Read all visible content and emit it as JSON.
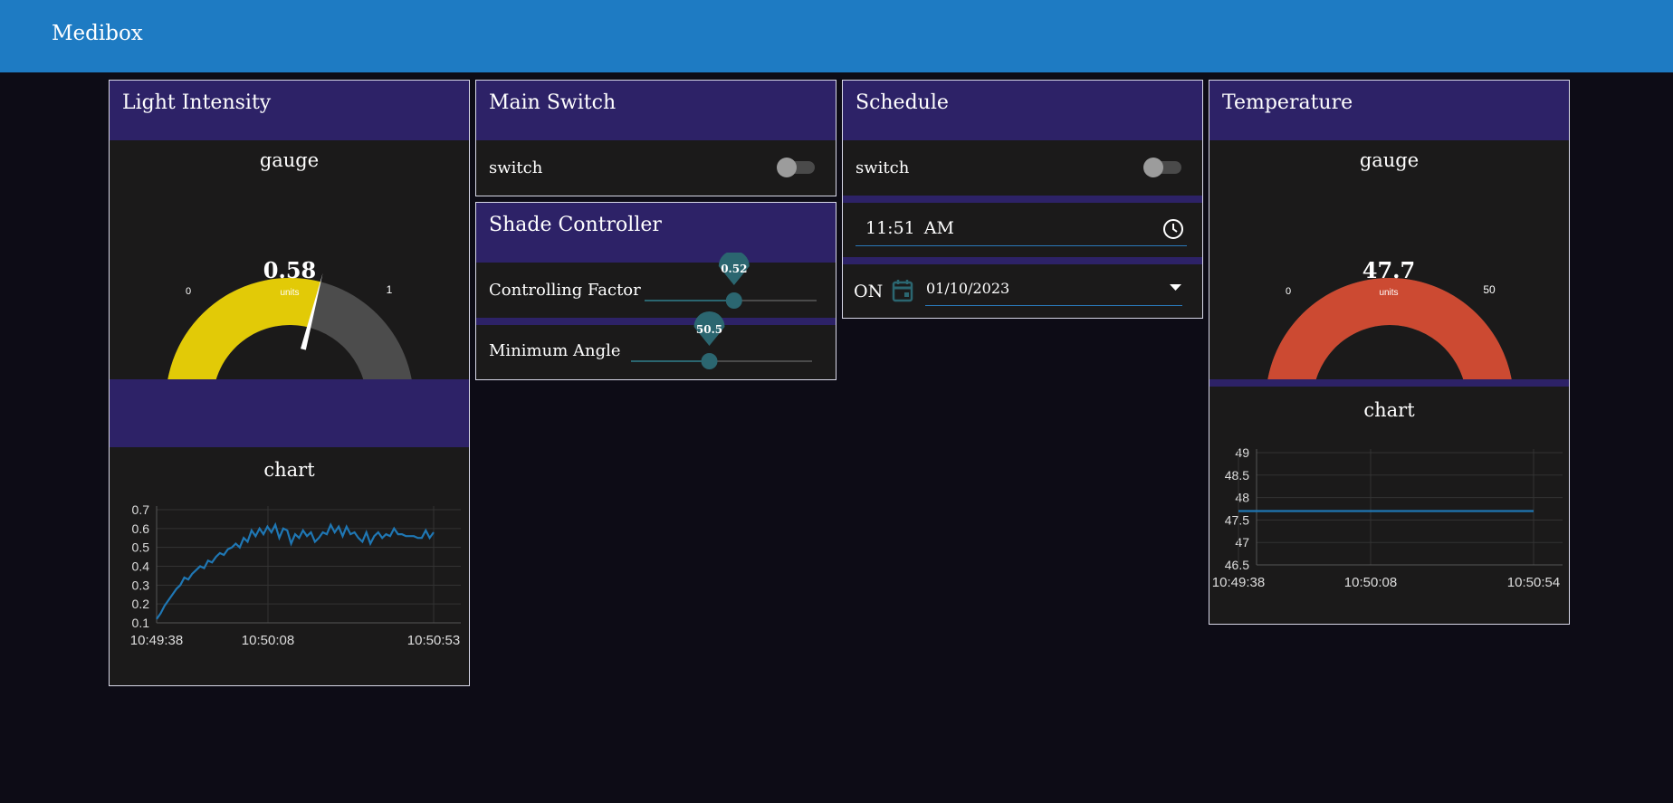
{
  "app": {
    "title": "Medibox"
  },
  "light_intensity": {
    "title": "Light Intensity",
    "gauge": {
      "label": "gauge",
      "value": "0.58",
      "value_num": 0.58,
      "min": "0",
      "max": "1",
      "min_num": 0,
      "max_num": 1,
      "units": "units",
      "color": "#e2ca07"
    },
    "chart_title": "chart"
  },
  "main_switch": {
    "title": "Main Switch",
    "switch_label": "switch",
    "on": false
  },
  "shade_controller": {
    "title": "Shade Controller",
    "controlling_factor": {
      "label": "Controlling Factor",
      "value": "0.52",
      "fraction": 0.52
    },
    "minimum_angle": {
      "label": "Minimum Angle",
      "value": "50.5",
      "fraction": 0.42
    }
  },
  "schedule": {
    "title": "Schedule",
    "switch_label": "switch",
    "on": false,
    "time": "11:51 AM",
    "on_label": "ON",
    "date": "01/10/2023"
  },
  "temperature": {
    "title": "Temperature",
    "gauge": {
      "label": "gauge",
      "value": "47.7",
      "value_num": 47.7,
      "min": "0",
      "max": "50",
      "min_num": 0,
      "max_num": 50,
      "units": "units",
      "color": "#cc4a32"
    },
    "chart_title": "chart"
  },
  "chart_data": [
    {
      "type": "line",
      "title": "chart",
      "x_ticks": [
        "10:49:38",
        "10:50:08",
        "10:50:53"
      ],
      "y_ticks": [
        "0.1",
        "0.2",
        "0.3",
        "0.4",
        "0.5",
        "0.6",
        "0.7"
      ],
      "ylim": [
        0.1,
        0.7
      ],
      "x_seconds_range": [
        0,
        75
      ],
      "color": "#1f77b4",
      "grid": true,
      "series": [
        {
          "values": [
            0.12,
            0.15,
            0.19,
            0.22,
            0.25,
            0.28,
            0.3,
            0.34,
            0.33,
            0.36,
            0.38,
            0.4,
            0.39,
            0.43,
            0.42,
            0.45,
            0.47,
            0.46,
            0.49,
            0.5,
            0.52,
            0.5,
            0.55,
            0.53,
            0.59,
            0.56,
            0.6,
            0.57,
            0.61,
            0.58,
            0.62,
            0.55,
            0.6,
            0.59,
            0.52,
            0.57,
            0.55,
            0.59,
            0.56,
            0.58,
            0.53,
            0.55,
            0.58,
            0.57,
            0.62,
            0.58,
            0.61,
            0.56,
            0.61,
            0.57,
            0.58,
            0.55,
            0.53,
            0.58,
            0.52,
            0.56,
            0.58,
            0.55,
            0.57,
            0.56,
            0.6,
            0.57,
            0.57,
            0.56,
            0.56,
            0.56,
            0.55,
            0.55,
            0.59,
            0.55,
            0.58
          ]
        }
      ]
    },
    {
      "type": "line",
      "title": "chart",
      "x_ticks": [
        "10:49:38",
        "10:50:08",
        "10:50:54"
      ],
      "y_ticks": [
        "46.5",
        "47",
        "47.5",
        "48",
        "48.5",
        "49"
      ],
      "ylim": [
        46.5,
        49
      ],
      "color": "#1f77b4",
      "grid": true,
      "series": [
        {
          "values": [
            47.7,
            47.7
          ]
        }
      ]
    }
  ]
}
